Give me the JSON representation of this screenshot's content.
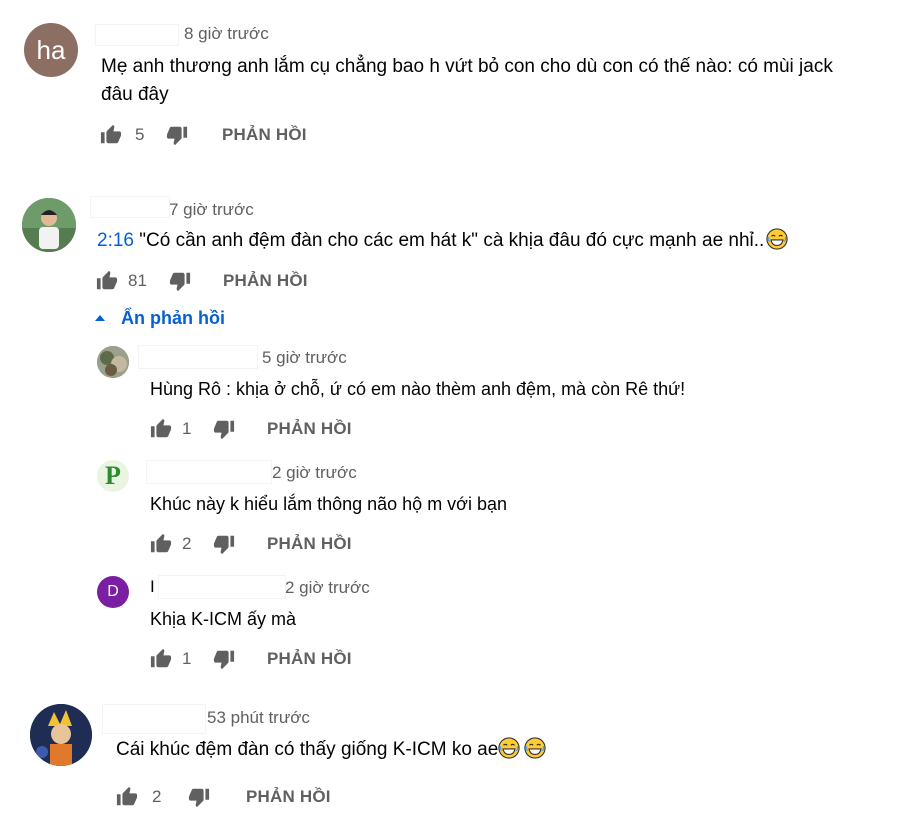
{
  "comments": [
    {
      "avatar_text": "ha",
      "avatar_color": "#8d6e63",
      "time": "8 giờ trước",
      "text_line1": "Mẹ anh thương anh lắm cụ chẳng bao h vứt bỏ con cho dù con có thế nào: có mùi jack",
      "text_line2": "đâu đây",
      "likes": "5",
      "reply_label": "PHẢN HỒI"
    },
    {
      "avatar_color": "#7aa07a",
      "time": "7 giờ trước",
      "timestamp_link": "2:16",
      "text": " \"Có cần anh đệm đàn cho các em hát k\" cà khịa đâu đó cực mạnh ae nhỉ..",
      "likes": "81",
      "reply_label": "PHẢN HỒI",
      "toggle_label": "Ẩn phản hồi",
      "replies": [
        {
          "avatar_color": "#8a8f7a",
          "time": "5 giờ trước",
          "text": "Hùng Rô : khịa ở chỗ, ứ có em nào thèm anh đệm, mà còn Rê thứ!",
          "likes": "1",
          "reply_label": "PHẢN HỒI"
        },
        {
          "avatar_letter": "P",
          "avatar_color": "#e9f5e1",
          "avatar_letter_color": "#2e8b2e",
          "time": "2 giờ trước",
          "text": "Khúc này k hiểu lắm thông não hộ m với bạn",
          "likes": "2",
          "reply_label": "PHẢN HỒI"
        },
        {
          "avatar_letter": "D",
          "avatar_color": "#7b1fa2",
          "name_initial": "I",
          "time": "2 giờ trước",
          "text": "Khịa K-ICM ấy mà",
          "likes": "1",
          "reply_label": "PHẢN HỒI"
        }
      ]
    },
    {
      "avatar_color": "#2c3e6b",
      "time": "53 phút trước",
      "text": "Cái khúc đệm đàn có thấy giống K-ICM ko ae",
      "likes": "2",
      "reply_label": "PHẢN HỒI"
    }
  ]
}
